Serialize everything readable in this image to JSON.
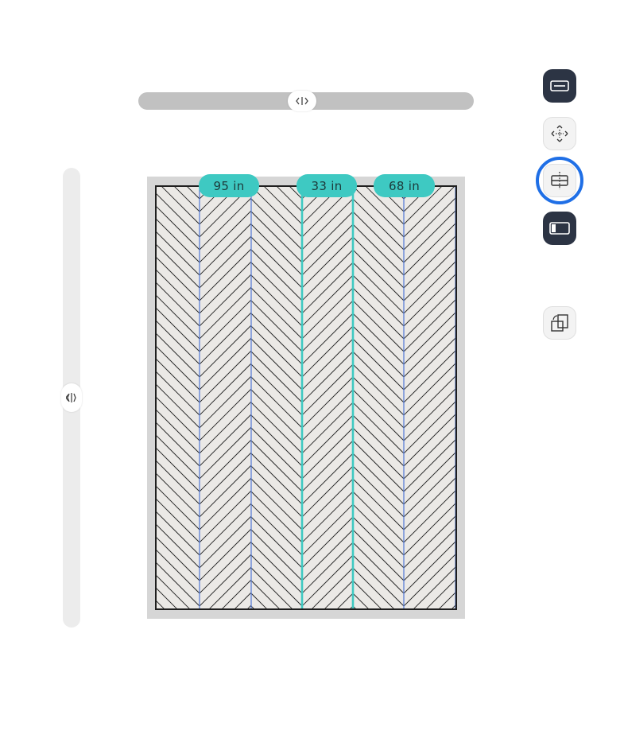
{
  "measurements": {
    "left": "95 in",
    "middle": "33 in",
    "right": "68 in"
  },
  "toolbar": {
    "items": [
      {
        "name": "pattern-icon",
        "state": "active-dark"
      },
      {
        "name": "move-icon",
        "state": "default"
      },
      {
        "name": "split-column-icon",
        "state": "focused"
      },
      {
        "name": "panel-icon",
        "state": "active-dark"
      },
      {
        "name": "rotate-icon",
        "state": "default"
      }
    ]
  },
  "sliders": {
    "horizontal_thumb_glyph": "⟨|⟩",
    "vertical_thumb_glyph": "⟨|⟩"
  },
  "colors": {
    "accent_teal": "#3ec9c2",
    "guide_blue": "#5b7fd6",
    "toolbar_dark": "#2c3444",
    "focus_blue": "#1f6fe6",
    "floor_tile": "#ebe9e6"
  }
}
